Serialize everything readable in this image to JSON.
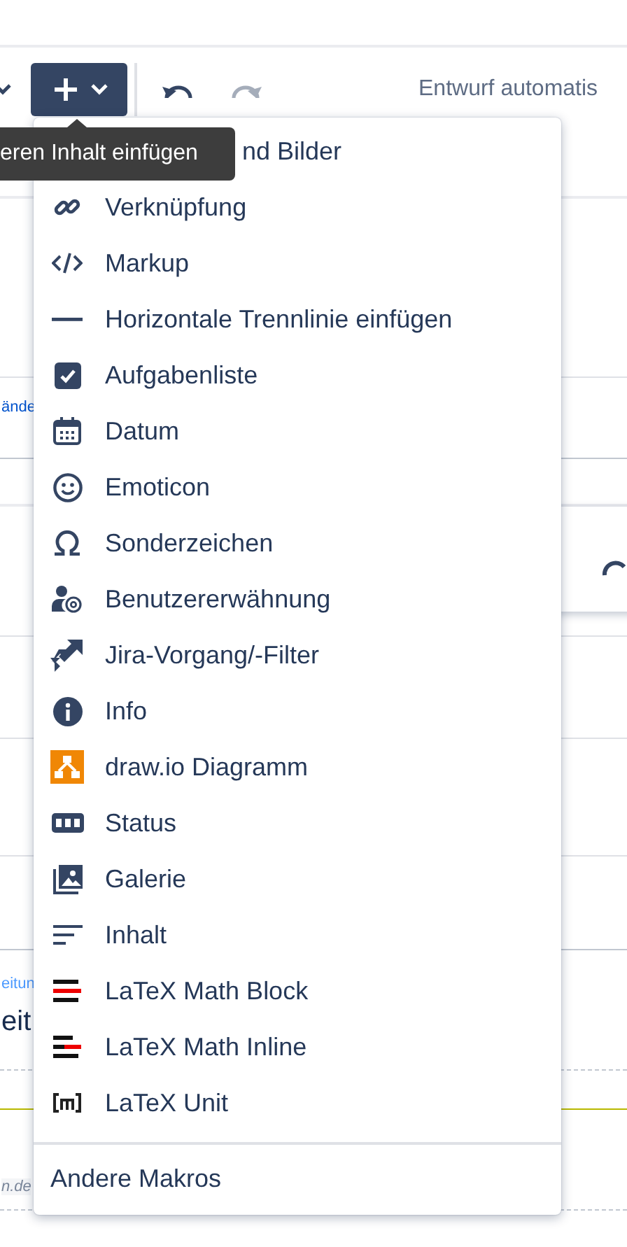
{
  "toolbar": {
    "autosave_text": "Entwurf automatis"
  },
  "tooltip": "eren Inhalt einfügen",
  "menu": {
    "items": [
      {
        "kind": "files",
        "label": "nd Bilder"
      },
      {
        "kind": "link",
        "label": "Verknüpfung"
      },
      {
        "kind": "markup",
        "label": "Markup"
      },
      {
        "kind": "rule",
        "label": "Horizontale Trennlinie einfügen"
      },
      {
        "kind": "task",
        "label": "Aufgabenliste"
      },
      {
        "kind": "date",
        "label": "Datum"
      },
      {
        "kind": "emoticon",
        "label": "Emoticon"
      },
      {
        "kind": "omega",
        "label": "Sonderzeichen"
      },
      {
        "kind": "mention",
        "label": "Benutzererwähnung"
      },
      {
        "kind": "jira",
        "label": "Jira-Vorgang/-Filter"
      },
      {
        "kind": "info",
        "label": "Info"
      },
      {
        "kind": "drawio",
        "label": "draw.io Diagramm"
      },
      {
        "kind": "status",
        "label": "Status"
      },
      {
        "kind": "gallery",
        "label": "Galerie"
      },
      {
        "kind": "toc",
        "label": "Inhalt"
      },
      {
        "kind": "latex_block",
        "label": "LaTeX Math Block"
      },
      {
        "kind": "latex_inline",
        "label": "LaTeX Math Inline"
      },
      {
        "kind": "latex_unit",
        "label": "LaTeX Unit"
      }
    ],
    "footer": "Andere Makros"
  },
  "background": {
    "side_link": "ände",
    "caption": "eitun",
    "heading": "eit",
    "footer_link": "n.de"
  }
}
